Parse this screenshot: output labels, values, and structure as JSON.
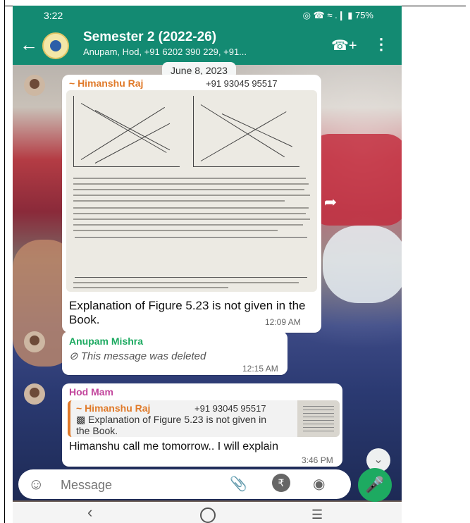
{
  "status": {
    "time": "3:22",
    "right": "◎ ☎ ≈ .❙ ▮ 75%"
  },
  "header": {
    "title": "Semester  2 (2022-26)",
    "subtitle": "Anupam, Hod, +91 6202 390 229, +91..."
  },
  "date_chip": "June 8, 2023",
  "messages": [
    {
      "sender": "~ Himanshu Raj",
      "phone": "+91 93045 95517",
      "text": "Explanation of Figure 5.23 is not given in the Book.",
      "time": "12:09 AM",
      "sender_color": "#e07a2a"
    },
    {
      "sender": "Anupam Mishra",
      "text": "This message was deleted",
      "time": "12:15 AM",
      "sender_color": "#1daa61"
    },
    {
      "sender": "Hod Mam",
      "sender_color": "#c2459c",
      "quote": {
        "sender": "~ Himanshu Raj",
        "phone": "+91 93045 95517",
        "text": "Explanation of Figure 5.23 is not given in the Book."
      },
      "text": "Himanshu call me tomorrow.. I will explain",
      "time": "3:46 PM"
    }
  ],
  "composer": {
    "placeholder": "Message"
  },
  "colors": {
    "header": "#138a72",
    "mic": "#1daa61"
  }
}
